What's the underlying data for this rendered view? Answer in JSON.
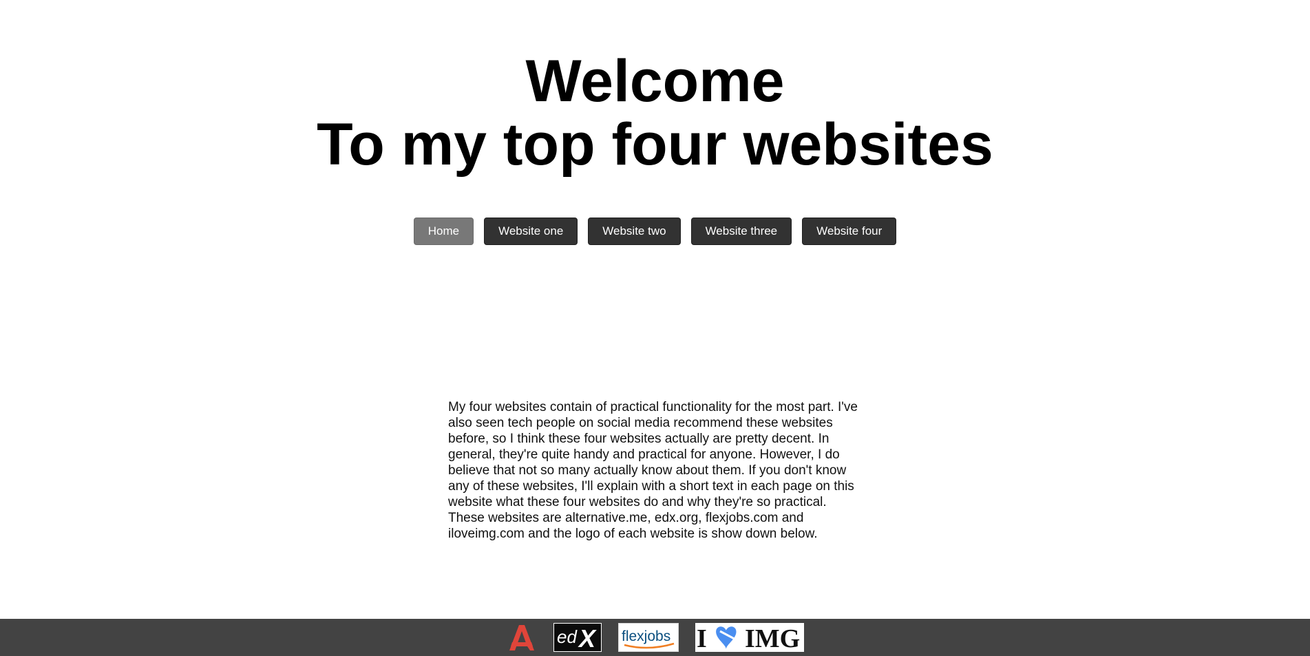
{
  "heading": {
    "line1": "Welcome",
    "line2": "To my top four websites"
  },
  "nav": {
    "items": [
      {
        "label": "Home",
        "active": true
      },
      {
        "label": "Website one",
        "active": false
      },
      {
        "label": "Website two",
        "active": false
      },
      {
        "label": "Website three",
        "active": false
      },
      {
        "label": "Website four",
        "active": false
      }
    ]
  },
  "intro": {
    "text": "My four websites contain of practical functionality for the most part. I've also seen tech people on social media recommend these websites before, so I think these four websites actually are pretty decent. In general, they're quite handy and practical for anyone. However, I do believe that not so many actually know about them. If you don't know any of these websites, I'll explain with a short text in each page on this website what these four websites do and why they're so practical. These websites are alternative.me, edx.org, flexjobs.com and iloveimg.com and the logo of each website is show down below."
  },
  "footer": {
    "logos": [
      {
        "icon": "alternative-me-logo",
        "text": "A",
        "color": "#e0453a"
      },
      {
        "icon": "edx-logo",
        "text": "edX"
      },
      {
        "icon": "flexjobs-logo",
        "text": "flexjobs",
        "color": "#0b4f80",
        "accent": "#f07f24"
      },
      {
        "icon": "iloveimg-logo",
        "text_left": "I",
        "text_right": "IMG",
        "heart_color": "#4a8ef0"
      }
    ]
  },
  "colors": {
    "button_bg": "#323232",
    "button_active_bg": "#787878",
    "footer_bg": "#434343"
  }
}
